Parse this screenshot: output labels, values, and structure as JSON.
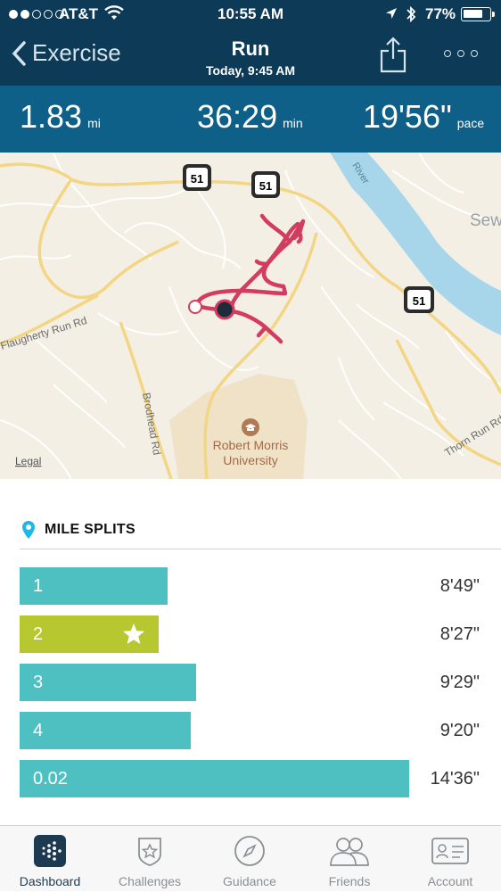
{
  "status_bar": {
    "carrier": "AT&T",
    "time": "10:55 AM",
    "battery": "77%",
    "battery_level": 0.77,
    "signal_bars": 2
  },
  "nav": {
    "back_label": "Exercise",
    "title": "Run",
    "subtitle": "Today, 9:45 AM"
  },
  "stats": [
    {
      "value": "1.83",
      "unit": "mi"
    },
    {
      "value": "36:29",
      "unit": "min"
    },
    {
      "value": "19'56\"",
      "unit": "pace"
    }
  ],
  "map": {
    "labels": {
      "route_a": "51",
      "route_b": "51",
      "route_c": "51",
      "flaugherty": "Flaugherty Run Rd",
      "brodhead": "Brodhead Rd",
      "university_1": "Robert Morris",
      "university_2": "University",
      "thorn": "Thorn Run Rd",
      "sew": "Sew",
      "river": "River",
      "legal": "Legal"
    }
  },
  "splits": {
    "title": "MILE SPLITS",
    "rows": [
      {
        "label": "1",
        "time": "8'49\"",
        "color": "#4ec0c1",
        "fraction": 0.32,
        "best": false
      },
      {
        "label": "2",
        "time": "8'27\"",
        "color": "#b6c72f",
        "fraction": 0.3,
        "best": true
      },
      {
        "label": "3",
        "time": "9'29\"",
        "color": "#4ec0c1",
        "fraction": 0.38,
        "best": false
      },
      {
        "label": "4",
        "time": "9'20\"",
        "color": "#4ec0c1",
        "fraction": 0.37,
        "best": false
      },
      {
        "label": "0.02",
        "time": "14'36\"",
        "color": "#4ec0c1",
        "fraction": 0.84,
        "best": false
      }
    ]
  },
  "tabs": [
    {
      "label": "Dashboard",
      "icon": "dashboard-icon",
      "active": true
    },
    {
      "label": "Challenges",
      "icon": "challenges-star-badge-icon",
      "active": false
    },
    {
      "label": "Guidance",
      "icon": "compass-icon",
      "active": false
    },
    {
      "label": "Friends",
      "icon": "friends-icon",
      "active": false
    },
    {
      "label": "Account",
      "icon": "account-card-icon",
      "active": false
    }
  ],
  "colors": {
    "header_bg": "#0d3a57",
    "stats_bg": "#0e6088",
    "route": "#d23c5f",
    "split_teal": "#4ec0c1",
    "split_best": "#b6c72f",
    "pin": "#1fb8e6"
  }
}
